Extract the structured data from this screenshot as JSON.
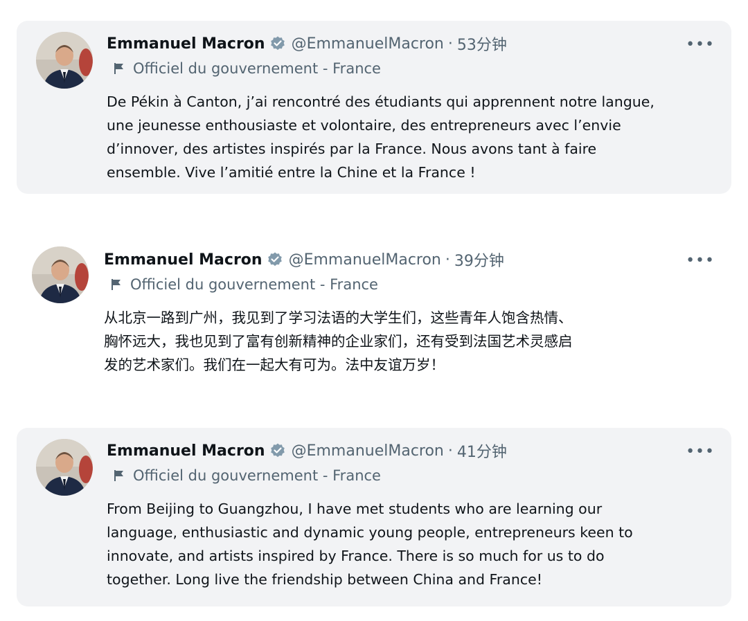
{
  "tweets": [
    {
      "name": "Emmanuel Macron",
      "handle": "@EmmanuelMacron",
      "separator": "·",
      "time": "53分钟",
      "label": "Officiel du gouvernement - France",
      "more": "•••",
      "text_lines": [
        "De Pékin à Canton, j’ai rencontré des étudiants qui apprennent notre langue,",
        "une jeunesse enthousiaste et volontaire, des entrepreneurs avec l’envie",
        "d’innover, des artistes inspirés par la France. Nous avons tant à faire",
        "ensemble. Vive l’amitié entre la Chine et la France !"
      ]
    },
    {
      "name": "Emmanuel Macron",
      "handle": "@EmmanuelMacron",
      "separator": "·",
      "time": "39分钟",
      "label": "Officiel du gouvernement - France",
      "more": "•••",
      "text_lines": [
        "从北京一路到广州，我见到了学习法语的大学生们，这些青年人饱含热情、",
        "胸怀远大，我也见到了富有创新精神的企业家们，还有受到法国艺术灵感启",
        "发的艺术家们。我们在一起大有可为。法中友谊万岁！"
      ]
    },
    {
      "name": "Emmanuel Macron",
      "handle": "@EmmanuelMacron",
      "separator": "·",
      "time": "41分钟",
      "label": "Officiel du gouvernement - France",
      "more": "•••",
      "text_lines": [
        "From Beijing to Guangzhou, I have met students who are learning our",
        "language, enthusiastic and dynamic young people, entrepreneurs keen to",
        "innovate, and artists inspired by France. There is so much for us to do",
        "together. Long live the friendship between China and France!"
      ]
    }
  ],
  "colors": {
    "card_background": "#f2f3f5",
    "primary_text": "#0f1419",
    "secondary_text": "#536471",
    "verified_badge": "#829aab"
  },
  "icons": {
    "verified": "verified-badge-icon",
    "label": "flag-icon",
    "more": "more-options-icon"
  }
}
